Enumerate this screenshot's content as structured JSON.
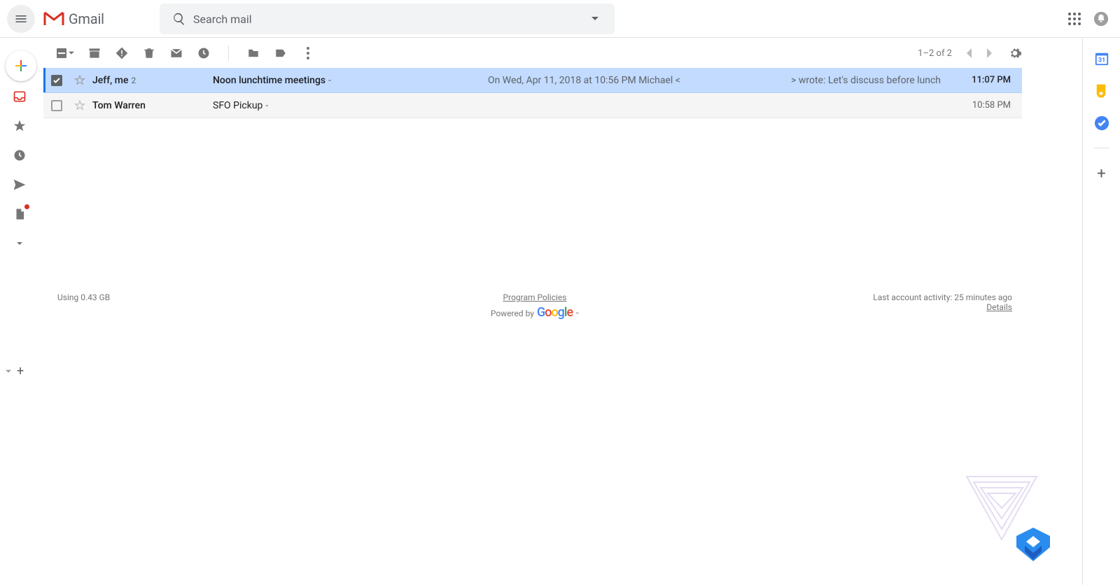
{
  "header": {
    "app_name": "Gmail",
    "search_placeholder": "Search mail"
  },
  "toolbar": {
    "page_range": "1–2 of 2"
  },
  "emails": [
    {
      "sender": "Jeff, me",
      "thread_count": "2",
      "subject": "Noon lunchtime meetings",
      "snippet_left": "On Wed, Apr 11, 2018 at 10:56 PM Michael <",
      "snippet_right": "> wrote: Let's discuss before lunch",
      "time": "11:07 PM",
      "selected": true
    },
    {
      "sender": "Tom Warren",
      "thread_count": "",
      "subject": "SFO Pickup",
      "snippet_left": "",
      "snippet_right": "",
      "time": "10:58 PM",
      "selected": false
    }
  ],
  "footer": {
    "storage": "Using 0.43 GB",
    "policies": "Program Policies",
    "powered_by": "Powered by",
    "activity": "Last account activity: 25 minutes ago",
    "details": "Details"
  },
  "side": {
    "calendar_day": "31"
  }
}
